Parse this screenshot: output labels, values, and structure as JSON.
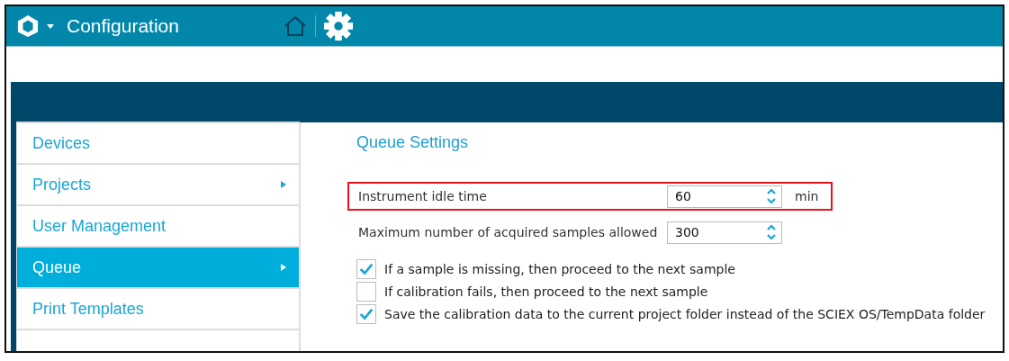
{
  "header": {
    "title": "Configuration"
  },
  "sidebar": {
    "items": [
      {
        "label": "Devices",
        "selected": false,
        "has_submenu": false
      },
      {
        "label": "Projects",
        "selected": false,
        "has_submenu": true
      },
      {
        "label": "User Management",
        "selected": false,
        "has_submenu": false
      },
      {
        "label": "Queue",
        "selected": true,
        "has_submenu": true
      },
      {
        "label": "Print Templates",
        "selected": false,
        "has_submenu": false
      }
    ]
  },
  "settings": {
    "title": "Queue Settings",
    "fields": [
      {
        "label": "Instrument idle time",
        "value": "60",
        "unit": "min",
        "highlighted": true
      },
      {
        "label": "Maximum number of acquired samples allowed",
        "value": "300",
        "highlighted": false
      }
    ],
    "options": [
      {
        "label": "If a sample is missing, then proceed to the next sample",
        "checked": true
      },
      {
        "label": "If calibration fails, then proceed to the next sample",
        "checked": false
      },
      {
        "label": "Save the calibration data to the current project folder instead of the SCIEX OS/TempData folder",
        "checked": true
      }
    ]
  }
}
